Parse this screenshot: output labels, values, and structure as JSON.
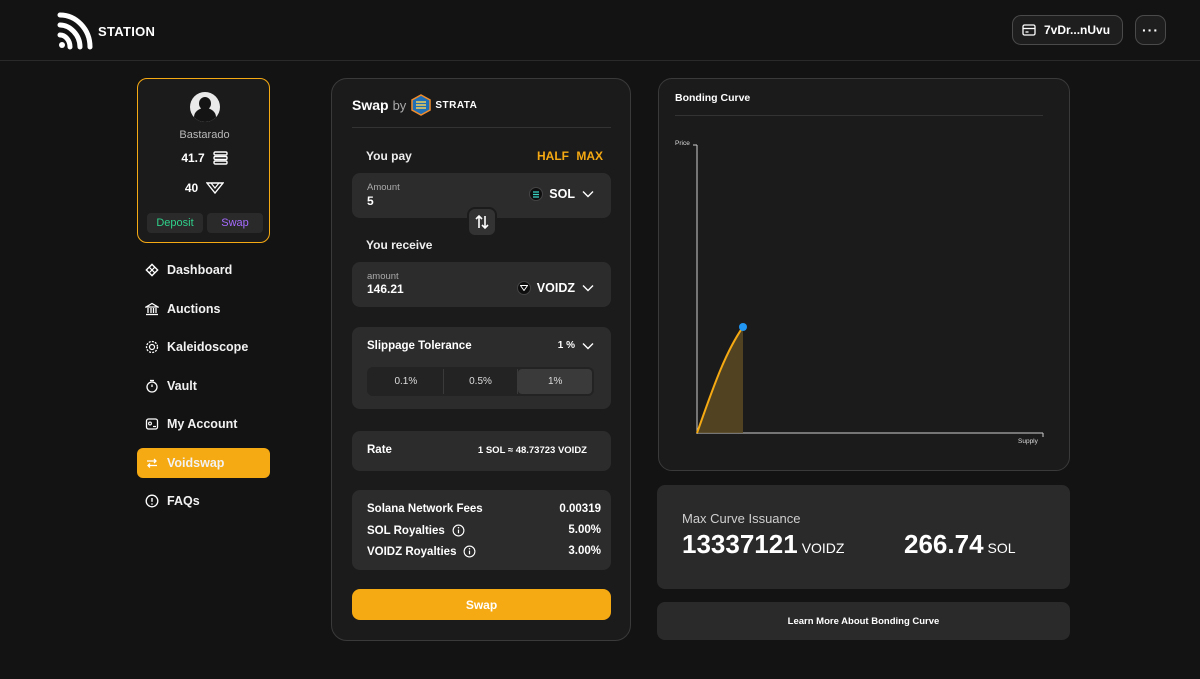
{
  "app": {
    "name": "STATION"
  },
  "wallet": {
    "address": "7vDr...nUvu"
  },
  "profile": {
    "username": "Bastarado",
    "balance_a": "41.7",
    "balance_b": "40",
    "deposit_label": "Deposit",
    "swap_label": "Swap"
  },
  "nav": {
    "items": [
      {
        "label": "Dashboard",
        "icon": "dashboard-icon"
      },
      {
        "label": "Auctions",
        "icon": "bank-icon"
      },
      {
        "label": "Kaleidoscope",
        "icon": "kaleidoscope-icon"
      },
      {
        "label": "Vault",
        "icon": "vault-icon"
      },
      {
        "label": "My Account",
        "icon": "account-icon"
      },
      {
        "label": "Voidswap",
        "icon": "swap-arrows-icon",
        "active": true
      },
      {
        "label": "FAQs",
        "icon": "info-icon"
      }
    ]
  },
  "swap": {
    "title": "Swap",
    "by": "by",
    "provider": "STRATA",
    "you_pay": "You pay",
    "half": "HALF",
    "max": "MAX",
    "pay_amount_label": "Amount",
    "pay_amount": "5",
    "pay_token": "SOL",
    "you_receive": "You receive",
    "receive_amount_label": "amount",
    "receive_amount": "146.21",
    "receive_token": "VOIDZ",
    "slippage_label": "Slippage Tolerance",
    "slippage_value": "1 %",
    "slippage_options": [
      "0.1%",
      "0.5%",
      "1%"
    ],
    "rate_label": "Rate",
    "rate_value": "1 SOL ≈ 48.73723 VOIDZ",
    "fees": [
      {
        "label": "Solana Network Fees",
        "value": "0.00319",
        "info": false
      },
      {
        "label": "SOL Royalties",
        "value": "5.00%",
        "info": true
      },
      {
        "label": "VOIDZ Royalties",
        "value": "3.00%",
        "info": true
      }
    ],
    "button_label": "Swap"
  },
  "curve": {
    "title": "Bonding Curve",
    "ylabel": "Price",
    "xlabel": "Supply"
  },
  "issuance": {
    "label": "Max Curve Issuance",
    "voidz_amount": "13337121",
    "voidz_unit": "VOIDZ",
    "sol_amount": "266.74",
    "sol_unit": "SOL"
  },
  "learn_more": "Learn More About Bonding Curve",
  "colors": {
    "accent": "#f5a912",
    "deposit": "#2fd18b",
    "swap": "#a56bff",
    "curve_point": "#1e88e5"
  }
}
